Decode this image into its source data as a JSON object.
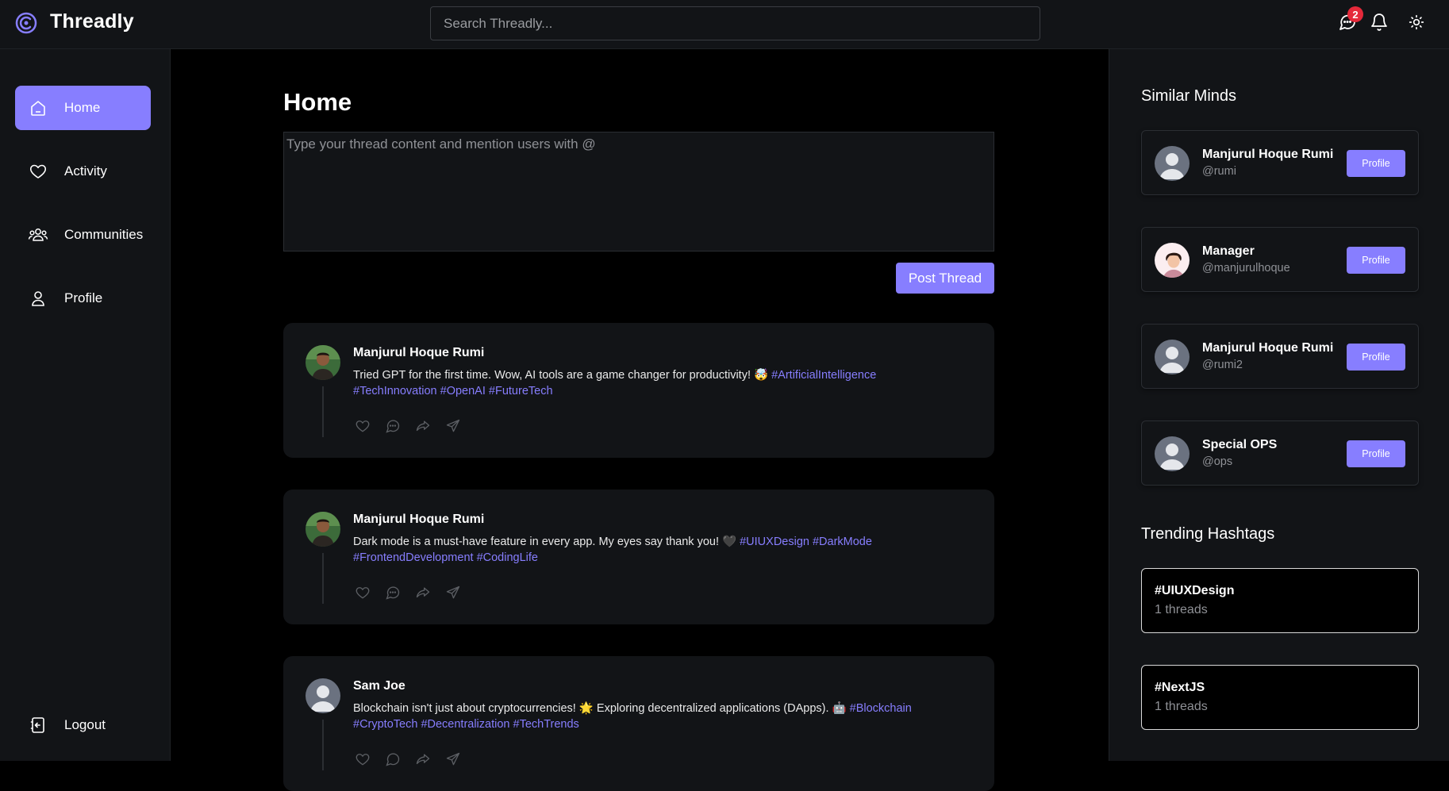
{
  "app": {
    "name": "Threadly"
  },
  "search": {
    "placeholder": "Search Threadly..."
  },
  "header": {
    "message_badge": "2"
  },
  "sidebar": {
    "items": [
      {
        "label": "Home",
        "icon": "home-icon",
        "active": true
      },
      {
        "label": "Activity",
        "icon": "heart-icon"
      },
      {
        "label": "Communities",
        "icon": "users-icon"
      },
      {
        "label": "Profile",
        "icon": "user-icon"
      }
    ],
    "logout": "Logout"
  },
  "main": {
    "title": "Home",
    "composer_placeholder": "Type your thread content and mention users with @",
    "post_button": "Post Thread",
    "threads": [
      {
        "author": "Manjurul Hoque Rumi",
        "text": "Tried GPT for the first time. Wow, AI tools are a game changer for productivity! 🤯",
        "tags": [
          "#ArtificialIntelligence",
          "#TechInnovation",
          "#OpenAI",
          "#FutureTech"
        ]
      },
      {
        "author": "Manjurul Hoque Rumi",
        "text": "Dark mode is a must-have feature in every app. My eyes say thank you! 🖤",
        "tags": [
          "#UIUXDesign",
          "#DarkMode",
          "#FrontendDevelopment",
          "#CodingLife"
        ]
      },
      {
        "author": "Sam Joe",
        "text": "Blockchain isn't just about cryptocurrencies! 🌟 Exploring decentralized applications (DApps). 🤖",
        "tags": [
          "#Blockchain",
          "#CryptoTech",
          "#Decentralization",
          "#TechTrends"
        ]
      }
    ]
  },
  "right": {
    "similar_title": "Similar Minds",
    "users": [
      {
        "name": "Manjurul Hoque Rumi",
        "handle": "@rumi",
        "button": "Profile"
      },
      {
        "name": "Manager",
        "handle": "@manjurulhoque",
        "button": "Profile"
      },
      {
        "name": "Manjurul Hoque Rumi",
        "handle": "@rumi2",
        "button": "Profile"
      },
      {
        "name": "Special OPS",
        "handle": "@ops",
        "button": "Profile"
      }
    ],
    "trending_title": "Trending Hashtags",
    "hashtags": [
      {
        "tag": "#UIUXDesign",
        "count": "1 threads"
      },
      {
        "tag": "#NextJS",
        "count": "1 threads"
      }
    ]
  },
  "colors": {
    "accent": "#877eff",
    "panel": "#121417",
    "badge": "#e5293a"
  }
}
